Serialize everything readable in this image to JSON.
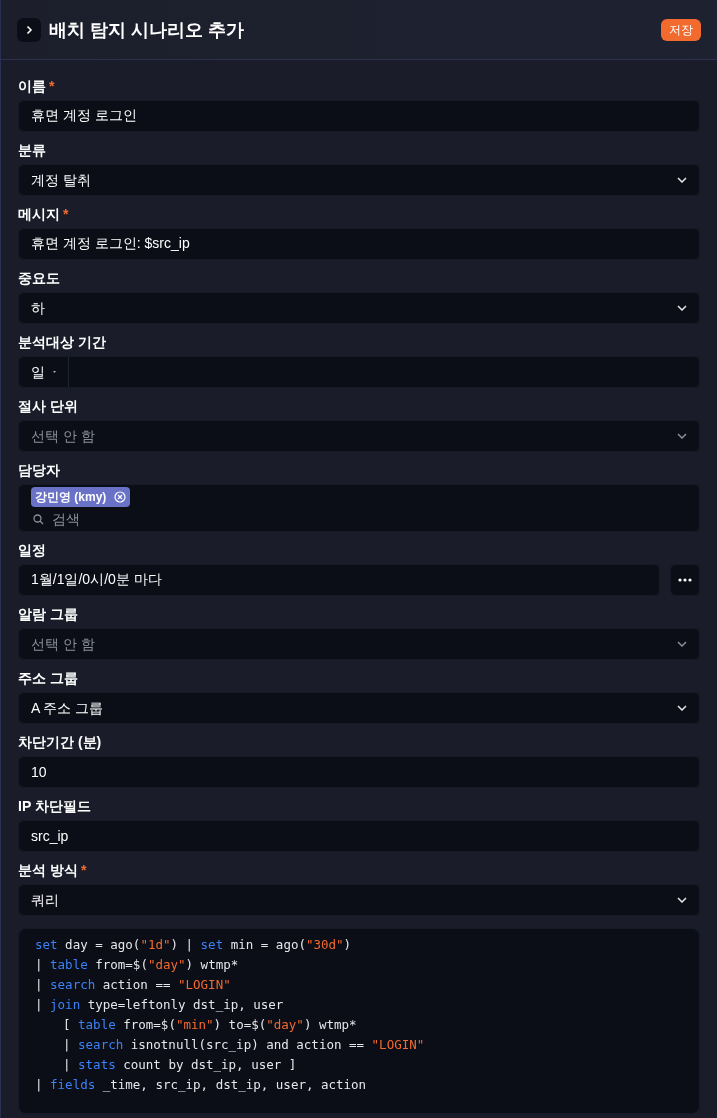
{
  "header": {
    "title": "배치 탐지 시나리오 추가",
    "save_button": "저장"
  },
  "fields": [
    {
      "kind": "text",
      "label": "이름",
      "required_mark": "*",
      "value": "휴면 계정 로그인"
    },
    {
      "kind": "select",
      "label": "분류",
      "value": "계정 탈취"
    },
    {
      "kind": "text",
      "label": "메시지",
      "required_mark": "*",
      "value": "휴면 계정 로그인: $src_ip"
    },
    {
      "kind": "select",
      "label": "중요도",
      "value": "하"
    },
    {
      "kind": "unit",
      "label": "분석대상 기간",
      "unit": "일"
    },
    {
      "kind": "select",
      "label": "절사 단위",
      "placeholder": "선택 안 함"
    },
    {
      "kind": "tags",
      "label": "담당자",
      "tags": [
        "강민영 (kmy)"
      ],
      "placeholder": "검색"
    },
    {
      "kind": "schedule",
      "label": "일정",
      "value": "1월/1일/0시/0분 마다"
    },
    {
      "kind": "select",
      "label": "알람 그룹",
      "placeholder": "선택 안 함"
    },
    {
      "kind": "select",
      "label": "주소 그룹",
      "value": "A 주소 그룹"
    },
    {
      "kind": "text",
      "label": "차단기간 (분)",
      "value": "10"
    },
    {
      "kind": "text",
      "label": "IP 차단필드",
      "value": "src_ip"
    },
    {
      "kind": "select",
      "label": "분석 방식",
      "required_mark": "*",
      "value": "쿼리"
    }
  ],
  "query": [
    {
      "tokens": [
        {
          "kind": "keyword",
          "text": "set"
        },
        {
          "kind": "plain",
          "text": " day = ago("
        },
        {
          "kind": "string",
          "text": "\"1d\""
        },
        {
          "kind": "plain",
          "text": ") | "
        },
        {
          "kind": "keyword",
          "text": "set"
        },
        {
          "kind": "plain",
          "text": " min = ago("
        },
        {
          "kind": "string",
          "text": "\"30d\""
        },
        {
          "kind": "plain",
          "text": ")"
        }
      ]
    },
    {
      "tokens": [
        {
          "kind": "plain",
          "text": "| "
        },
        {
          "kind": "keyword",
          "text": "table"
        },
        {
          "kind": "plain",
          "text": " from=$("
        },
        {
          "kind": "string",
          "text": "\"day\""
        },
        {
          "kind": "plain",
          "text": ") wtmp*"
        }
      ]
    },
    {
      "tokens": [
        {
          "kind": "plain",
          "text": "| "
        },
        {
          "kind": "keyword",
          "text": "search"
        },
        {
          "kind": "plain",
          "text": " action == "
        },
        {
          "kind": "string",
          "text": "\"LOGIN\""
        }
      ]
    },
    {
      "tokens": [
        {
          "kind": "plain",
          "text": "| "
        },
        {
          "kind": "keyword",
          "text": "join"
        },
        {
          "kind": "plain",
          "text": " type=leftonly dst_ip, user"
        }
      ],
      "children": [
        {
          "tokens": [
            {
              "kind": "plain",
              "text": "[ "
            },
            {
              "kind": "keyword",
              "text": "table"
            },
            {
              "kind": "plain",
              "text": " from=$("
            },
            {
              "kind": "string",
              "text": "\"min\""
            },
            {
              "kind": "plain",
              "text": ") to=$("
            },
            {
              "kind": "string",
              "text": "\"day\""
            },
            {
              "kind": "plain",
              "text": ") wtmp*"
            }
          ]
        },
        {
          "tokens": [
            {
              "kind": "plain",
              "text": "| "
            },
            {
              "kind": "keyword",
              "text": "search"
            },
            {
              "kind": "plain",
              "text": " isnotnull(src_ip) and action == "
            },
            {
              "kind": "string",
              "text": "\"LOGIN\""
            }
          ]
        },
        {
          "tokens": [
            {
              "kind": "plain",
              "text": "| "
            },
            {
              "kind": "keyword",
              "text": "stats"
            },
            {
              "kind": "plain",
              "text": " count by dst_ip, user ]"
            }
          ]
        }
      ]
    },
    {
      "tokens": [
        {
          "kind": "plain",
          "text": "| "
        },
        {
          "kind": "keyword",
          "text": "fields"
        },
        {
          "kind": "plain",
          "text": " _time, src_ip, dst_ip, user, action"
        }
      ]
    }
  ]
}
